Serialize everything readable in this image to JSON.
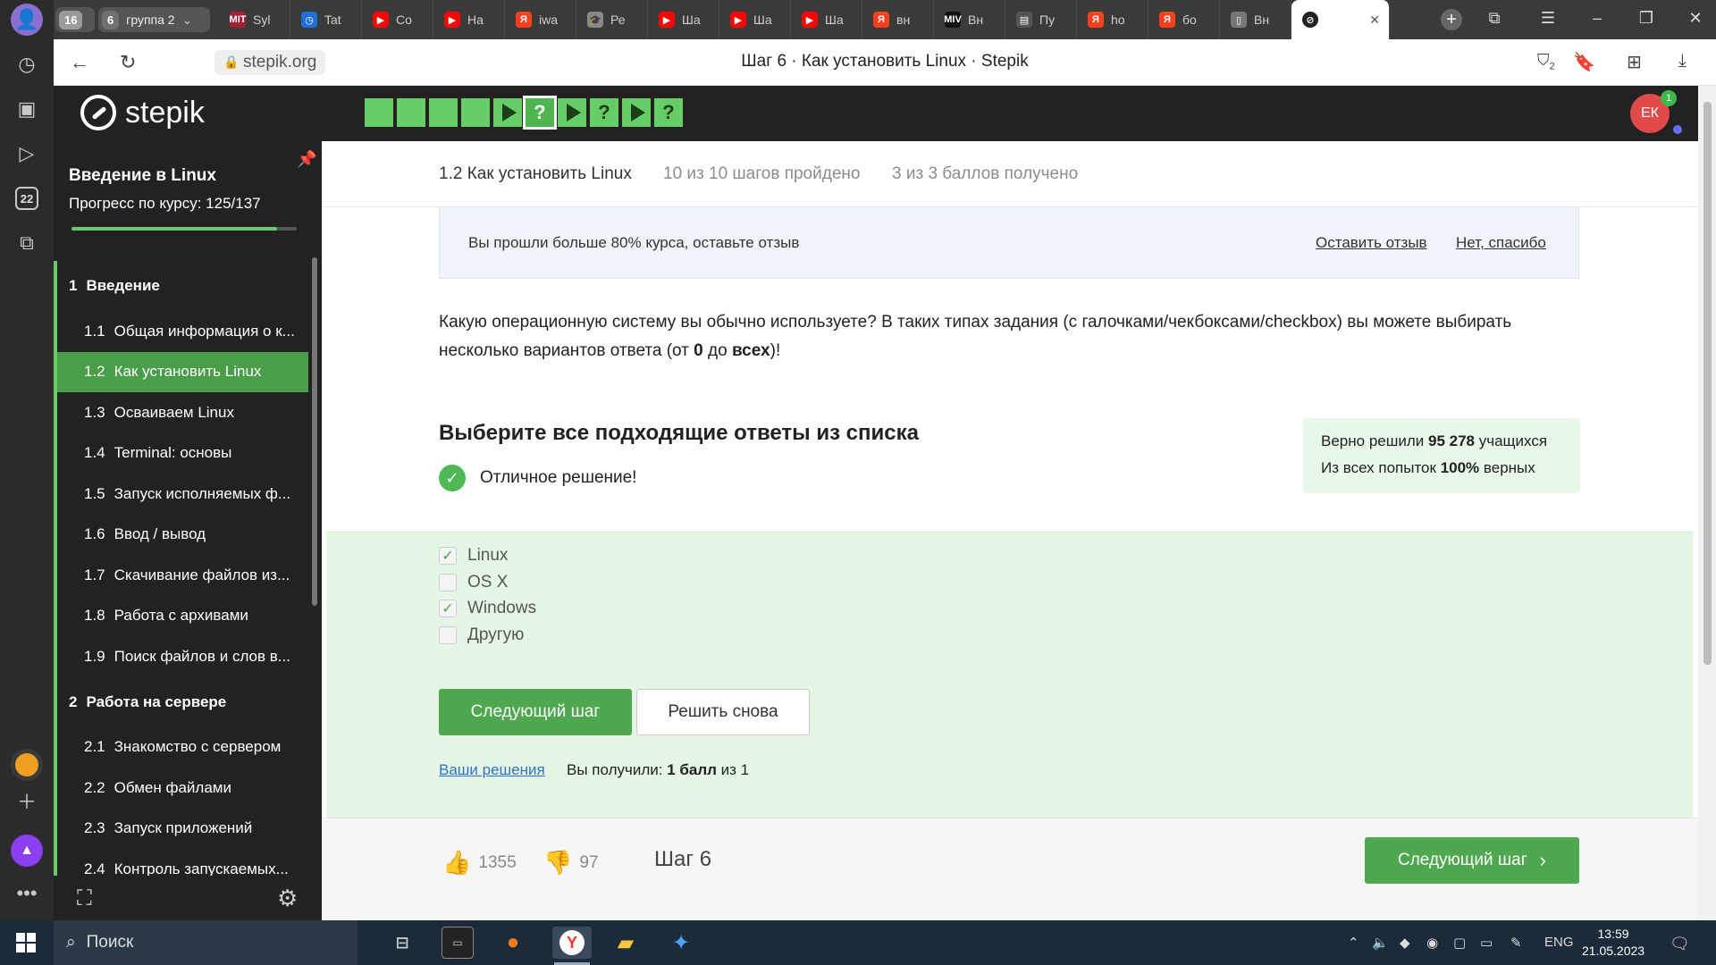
{
  "browser": {
    "tab_group_count": "16",
    "tab_group_badge": "6",
    "tab_group_name": "группа 2",
    "tabs": [
      {
        "label": "Syl",
        "icon": "mit-ocw-icon",
        "color": "#a31f34",
        "glyph": "MIT"
      },
      {
        "label": "Tat",
        "icon": "clock-icon",
        "color": "#1e6fd9",
        "glyph": "◷"
      },
      {
        "label": "Co",
        "icon": "youtube-icon",
        "color": "#ff0000",
        "glyph": "▶"
      },
      {
        "label": "На",
        "icon": "youtube-icon",
        "color": "#ff0000",
        "glyph": "▶"
      },
      {
        "label": "iwa",
        "icon": "yandex-icon",
        "color": "#fc3f1d",
        "glyph": "Я"
      },
      {
        "label": "Ре",
        "icon": "graduation-cap-icon",
        "color": "#888888",
        "glyph": "🎓"
      },
      {
        "label": "Ша",
        "icon": "youtube-icon",
        "color": "#ff0000",
        "glyph": "▶"
      },
      {
        "label": "Ша",
        "icon": "youtube-icon",
        "color": "#ff0000",
        "glyph": "▶"
      },
      {
        "label": "Ша",
        "icon": "youtube-icon",
        "color": "#ff0000",
        "glyph": "▶"
      },
      {
        "label": "вн",
        "icon": "yandex-icon",
        "color": "#fc3f1d",
        "glyph": "Я"
      },
      {
        "label": "Вн",
        "icon": "miv-icon",
        "color": "#111111",
        "glyph": "MIV"
      },
      {
        "label": "Пу",
        "icon": "document-icon",
        "color": "#555555",
        "glyph": "▤"
      },
      {
        "label": "ho",
        "icon": "yandex-icon",
        "color": "#fc3f1d",
        "glyph": "Я"
      },
      {
        "label": "бо",
        "icon": "yandex-icon",
        "color": "#fc3f1d",
        "glyph": "Я"
      },
      {
        "label": "Вн",
        "icon": "file-icon",
        "color": "#777777",
        "glyph": "▯"
      }
    ],
    "url": "stepik.org",
    "page_title": "Шаг 6 · Как установить Linux · Stepik",
    "calendar_day": "22",
    "extensions_badge": "2"
  },
  "header": {
    "logo_text": "stepik",
    "steps": [
      "box",
      "box",
      "box",
      "box",
      "play",
      "quiz",
      "play",
      "quiz",
      "play",
      "quiz"
    ],
    "current_step_index": 5,
    "quiz_glyph": "?",
    "avatar_initials": "ЕК",
    "notification_count": "1"
  },
  "sidebar": {
    "course_title": "Введение в Linux",
    "progress_label": "Прогресс по курсу:  125/137",
    "progress_fraction": 0.912,
    "sections": [
      {
        "number": "1",
        "title": "Введение",
        "items": [
          {
            "num": "1.1",
            "label": "Общая информация о к..."
          },
          {
            "num": "1.2",
            "label": "Как установить Linux",
            "active": true
          },
          {
            "num": "1.3",
            "label": "Осваиваем Linux"
          },
          {
            "num": "1.4",
            "label": "Terminal: основы"
          },
          {
            "num": "1.5",
            "label": "Запуск исполняемых ф..."
          },
          {
            "num": "1.6",
            "label": "Ввод / вывод"
          },
          {
            "num": "1.7",
            "label": "Скачивание файлов из..."
          },
          {
            "num": "1.8",
            "label": "Работа с архивами"
          },
          {
            "num": "1.9",
            "label": "Поиск файлов и слов в..."
          }
        ]
      },
      {
        "number": "2",
        "title": "Работа на сервере",
        "items": [
          {
            "num": "2.1",
            "label": "Знакомство с сервером"
          },
          {
            "num": "2.2",
            "label": "Обмен файлами"
          },
          {
            "num": "2.3",
            "label": "Запуск приложений"
          },
          {
            "num": "2.4",
            "label": "Контроль запускаемых..."
          }
        ]
      }
    ]
  },
  "lesson": {
    "title": "1.2 Как установить Linux",
    "steps_done": "10 из 10 шагов пройдено",
    "points": "3 из 3 баллов  получено"
  },
  "review": {
    "text": "Вы прошли больше 80% курса, оставьте отзыв",
    "leave_review": "Оставить отзыв",
    "no_thanks": "Нет, спасибо"
  },
  "question": {
    "part1": "Какую операционную систему вы обычно используете? В таких типах задания (с галочками/чекбоксами/checkbox) вы можете выбирать несколько вариантов ответа (от ",
    "bold1": "0",
    "part2": " до ",
    "bold2": "всех",
    "part3": ")!"
  },
  "task": {
    "title": "Выберите все подходящие ответы из списка",
    "success_text": "Отличное решение!",
    "stats_line1_prefix": "Верно решили ",
    "stats_line1_value": "95 278",
    "stats_line1_suffix": " учащихся",
    "stats_line2_prefix": "Из всех попыток ",
    "stats_line2_value": "100%",
    "stats_line2_suffix": " верных",
    "options": [
      {
        "label": "Linux",
        "checked": true
      },
      {
        "label": "OS X",
        "checked": false
      },
      {
        "label": "Windows",
        "checked": true
      },
      {
        "label": "Другую",
        "checked": false
      }
    ],
    "next_step_button": "Следующий шаг",
    "retry_button": "Решить снова",
    "your_solutions": "Ваши решения",
    "score_prefix": "Вы получили: ",
    "score_value": "1 балл",
    "score_suffix": " из 1"
  },
  "footer": {
    "likes": "1355",
    "dislikes": "97",
    "step_label": "Шаг 6",
    "next_button": "Следующий шаг"
  },
  "taskbar": {
    "search_placeholder": "Поиск",
    "language": "ENG",
    "time": "13:59",
    "date": "21.05.2023"
  }
}
